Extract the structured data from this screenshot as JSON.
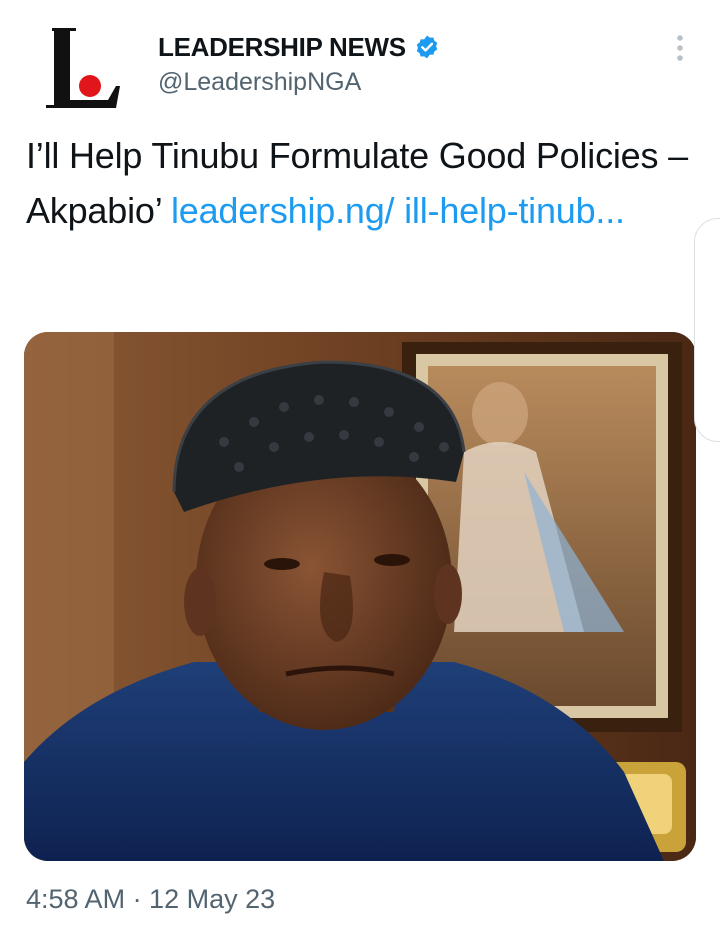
{
  "account": {
    "display_name": "LEADERSHIP NEWS",
    "handle": "@LeadershipNGA",
    "verified": true,
    "avatar_letter": "L",
    "avatar_icon": "leadership-logo-icon"
  },
  "tweet": {
    "text": "I’ll Help Tinubu Formulate Good Policies – Akpabio’ ",
    "link_text": "leadership.ng/ ill-help-tinub...",
    "timestamp": "4:58 AM · 12 May 23"
  },
  "icons": {
    "verified": "verified-badge-icon",
    "more": "more-options-icon"
  },
  "colors": {
    "link": "#1d9bf0",
    "secondary_text": "#536471",
    "logo_red": "#e0161b"
  }
}
